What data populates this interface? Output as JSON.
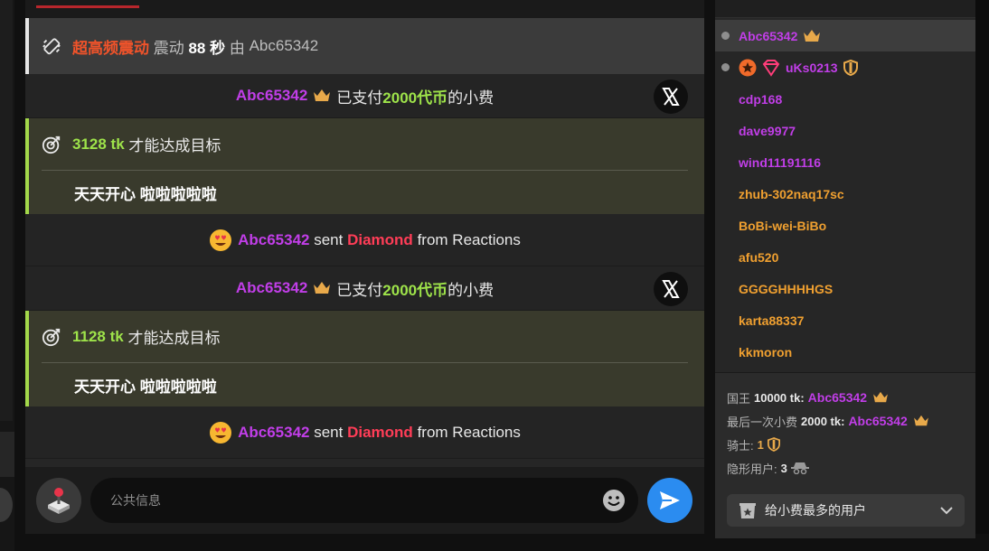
{
  "chat": {
    "system_message": {
      "title": "超高频震动",
      "action": "震动",
      "duration": "88 秒",
      "by": "由",
      "user": "Abc65342"
    },
    "messages": [
      {
        "type": "tip",
        "user": "Abc65342",
        "pre": "已支付",
        "amount": "2000代币",
        "post": "的小费"
      },
      {
        "type": "goal",
        "amount": "3128 tk",
        "text": "才能达成目标",
        "goal_text": "天天开心 啦啦啦啦啦"
      },
      {
        "type": "gift",
        "user": "Abc65342",
        "sent": "sent",
        "gift": "Diamond",
        "from": "from Reactions"
      },
      {
        "type": "tip",
        "user": "Abc65342",
        "pre": "已支付",
        "amount": "2000代币",
        "post": "的小费"
      },
      {
        "type": "goal",
        "amount": "1128 tk",
        "text": "才能达成目标",
        "goal_text": "天天开心 啦啦啦啦啦"
      },
      {
        "type": "gift",
        "user": "Abc65342",
        "sent": "sent",
        "gift": "Diamond",
        "from": "from Reactions"
      }
    ],
    "composer": {
      "placeholder": "公共信息"
    }
  },
  "users": [
    {
      "name": "Abc65342",
      "color": "#c13ee8",
      "selected": true
    },
    {
      "name": "uKs0213",
      "color": "#c13ee8"
    },
    {
      "name": "cdp168",
      "color": "#c13ee8"
    },
    {
      "name": "dave9977",
      "color": "#c13ee8"
    },
    {
      "name": "wind11191116",
      "color": "#c13ee8"
    },
    {
      "name": "zhub-302naq17sc",
      "color": "#f0a030"
    },
    {
      "name": "BoBi-wei-BiBo",
      "color": "#f0a030"
    },
    {
      "name": "afu520",
      "color": "#f0a030"
    },
    {
      "name": "GGGGHHHHGS",
      "color": "#f0a030"
    },
    {
      "name": "karta88337",
      "color": "#f0a030"
    },
    {
      "name": "kkmoron",
      "color": "#f0a030"
    }
  ],
  "stats": {
    "king_label": "国王",
    "king_amount": "10000 tk:",
    "king_user": "Abc65342",
    "last_label": "最后一次小费",
    "last_amount": "2000 tk:",
    "last_user": "Abc65342",
    "knight_label": "骑士:",
    "knight_count": "1",
    "hidden_label": "隐形用户:",
    "hidden_count": "3",
    "top_tipper_label": "给小费最多的用户"
  },
  "colors": {
    "accent_purple": "#c13ee8",
    "accent_green": "#9ee34a",
    "accent_red": "#ff3d57",
    "send_blue": "#2b8cf0"
  }
}
